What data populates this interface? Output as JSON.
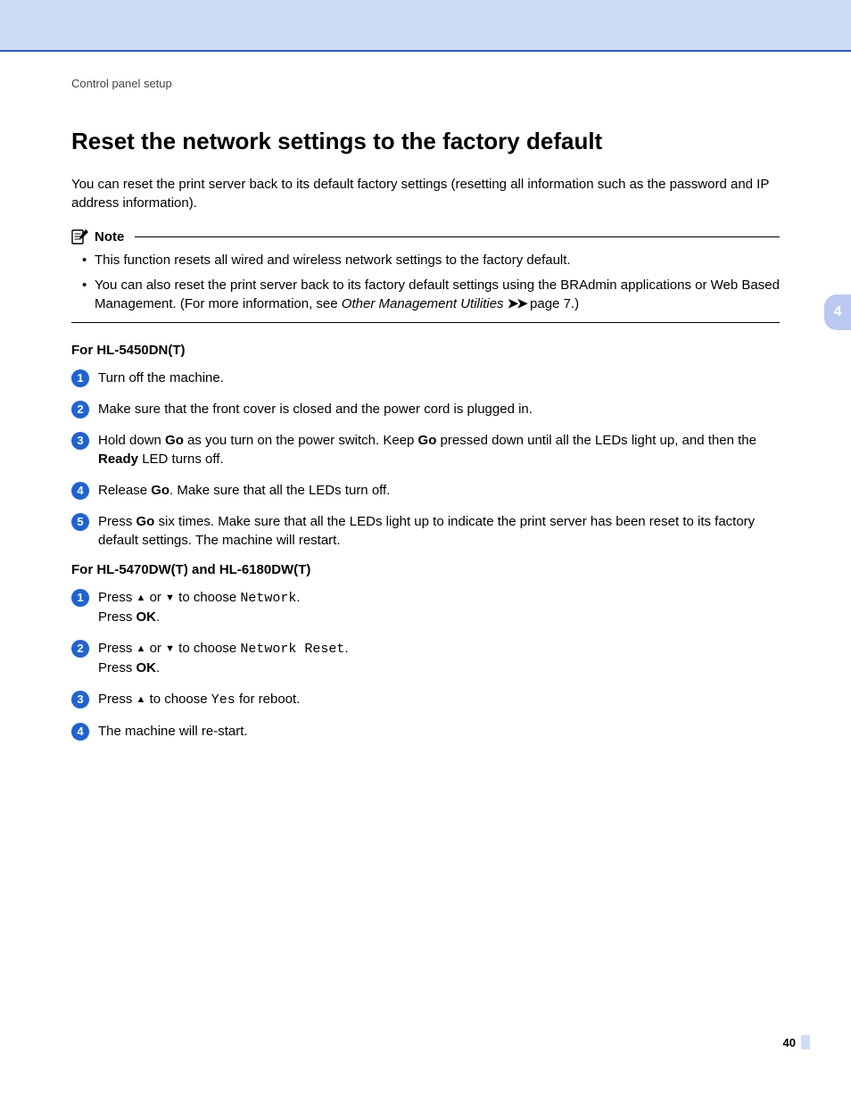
{
  "header": {
    "breadcrumb": "Control panel setup"
  },
  "title": "Reset the network settings to the factory default",
  "intro": "You can reset the print server back to its default factory settings (resetting all information such as the password and IP address information).",
  "note": {
    "label": "Note",
    "items": {
      "i1": "This function resets all wired and wireless network settings to the factory default.",
      "i2a": "You can also reset the print server back to its factory default settings using the BRAdmin applications or Web Based Management. (For more information, see ",
      "i2b": "Other Management Utilities",
      "i2c": " page 7.)"
    }
  },
  "sectionA": {
    "head": "For HL-5450DN(T)",
    "s1": "Turn off the machine.",
    "s2": "Make sure that the front cover is closed and the power cord is plugged in.",
    "s3a": "Hold down ",
    "s3go1": "Go",
    "s3b": " as you turn on the power switch. Keep ",
    "s3go2": "Go",
    "s3c": " pressed down until all the LEDs light up, and then the ",
    "s3ready": "Ready",
    "s3d": " LED turns off.",
    "s4a": "Release ",
    "s4go": "Go",
    "s4b": ". Make sure that all the LEDs turn off.",
    "s5a": "Press ",
    "s5go": "Go",
    "s5b": " six times. Make sure that all the LEDs light up to indicate the print server has been reset to its factory default settings. The machine will restart."
  },
  "sectionB": {
    "head": "For HL-5470DW(T) and HL-6180DW(T)",
    "s1a": "Press ",
    "s1b": " or ",
    "s1c": " to choose ",
    "s1net": "Network",
    "s1d": ".",
    "pressOK": "Press ",
    "ok": "OK",
    "period": ".",
    "s2a": "Press ",
    "s2b": " or ",
    "s2c": " to choose ",
    "s2net": "Network Reset",
    "s2d": ".",
    "s3a": "Press ",
    "s3b": " to choose ",
    "s3yes": "Yes",
    "s3c": " for reboot.",
    "s4": "The machine will re-start."
  },
  "sidetab": "4",
  "pageNumber": "40",
  "glyphs": {
    "upTri": "▲",
    "downTri": "▼",
    "dblArrow": "➤➤"
  }
}
